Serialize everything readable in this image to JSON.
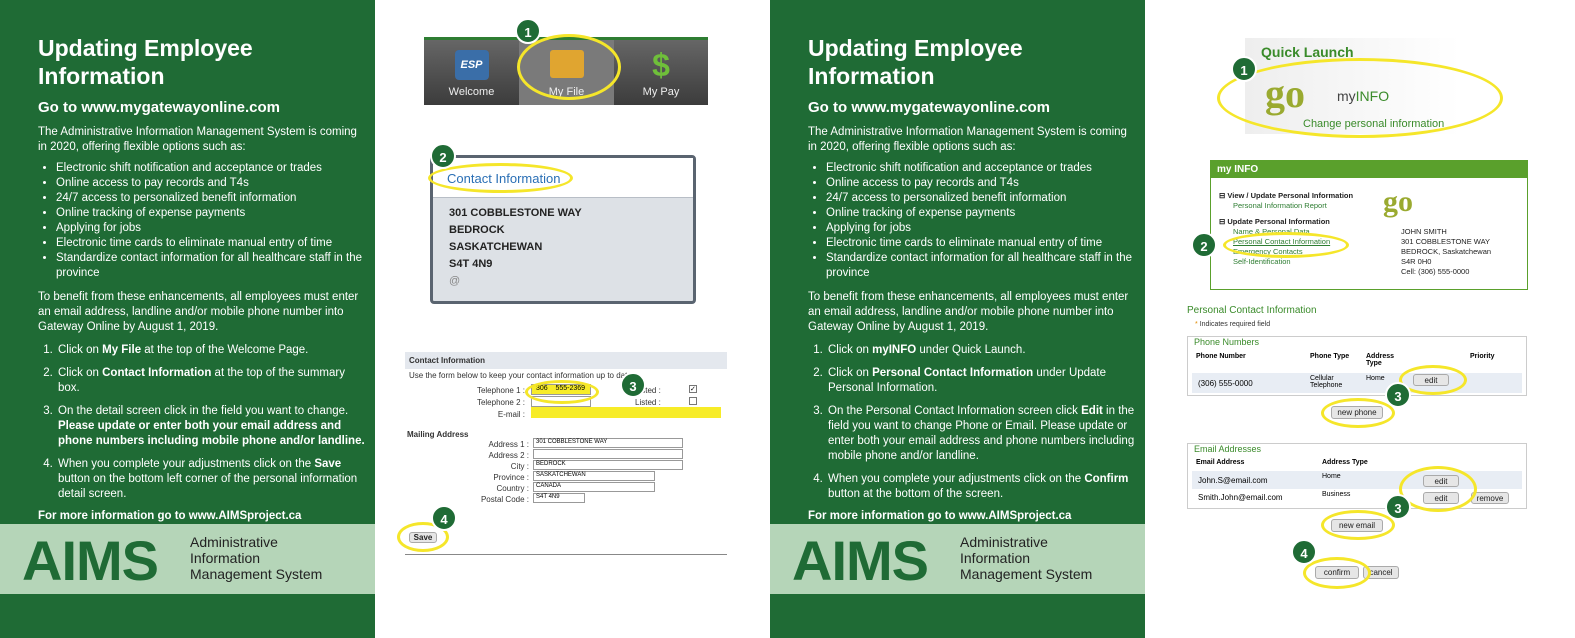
{
  "left_panel": {
    "title": "Updating Employee Information",
    "url_heading": "Go to www.mygatewayonline.com",
    "intro": "The Administrative Information Management System is coming in 2020, offering flexible options such as:",
    "bullets": [
      "Electronic shift notification and acceptance or trades",
      "Online access to pay records and T4s",
      "24/7 access to personalized benefit information",
      "Online tracking of expense payments",
      "Applying for jobs",
      "Electronic time cards to eliminate manual entry of time",
      "Standardize contact information for all healthcare staff in the province"
    ],
    "benefit": "To benefit from these enhancements, all employees must enter an email address, landline and/or mobile phone number into Gateway Online by August 1, 2019.",
    "steps": [
      {
        "pre": "Click on ",
        "bold": "My File",
        "post": " at the top of the Welcome Page."
      },
      {
        "pre": "Click on ",
        "bold": "Contact Information",
        "post": " at the top of the summary box."
      },
      {
        "pre": "On the detail screen click in the field you want to change. ",
        "bold": "Please update or enter both your email address and phone numbers including mobile phone and/or landline.",
        "post": ""
      },
      {
        "pre": "When you complete your adjustments click on the ",
        "bold": "Save",
        "post": " button on the bottom left corner of the personal information detail screen."
      }
    ],
    "more": "For more information go to www.AIMSproject.ca"
  },
  "right_panel": {
    "title": "Updating Employee Information",
    "url_heading": "Go to www.mygatewayonline.com",
    "intro": "The Administrative Information Management System is coming in 2020, offering flexible options such as:",
    "bullets": [
      "Electronic shift notification and acceptance or trades",
      "Online access to pay records and T4s",
      "24/7 access to personalized benefit information",
      "Online tracking of expense payments",
      "Applying for jobs",
      "Electronic time cards to eliminate manual entry of time",
      "Standardize contact information for all healthcare staff in the province"
    ],
    "benefit": "To benefit from these enhancements, all employees must enter an email address, landline and/or mobile phone number into Gateway Online by August 1, 2019.",
    "steps": [
      {
        "pre": "Click on ",
        "bold": "myINFO",
        "post": " under Quick Launch."
      },
      {
        "pre": "Click on ",
        "bold": "Personal Contact Information",
        "post": " under Update Personal Information."
      },
      {
        "pre": "On the Personal Contact Information screen click ",
        "bold": "Edit",
        "post": " in the field you want to change Phone or Email. Please update or enter both your email address and phone numbers including mobile phone and/or landline."
      },
      {
        "pre": "When you complete your adjustments click on the ",
        "bold": "Confirm",
        "post": " button at the bottom of the screen."
      }
    ],
    "more": "For more information go to www.AIMSproject.ca"
  },
  "logo": {
    "text": "AIMS",
    "line1": "Administrative",
    "line2": "Information",
    "line3": "Management System"
  },
  "shot1": {
    "nav": [
      "Welcome",
      "My File",
      "My Pay"
    ],
    "esp": "ESP",
    "contact_title": "Contact Information",
    "address": [
      "301 COBBLESTONE WAY",
      "BEDROCK",
      "SASKATCHEWAN",
      "S4T 4N9"
    ],
    "at": "@",
    "form_title": "Contact Information",
    "form_note": "Use the form below to keep your contact information up to date.",
    "tel1_label": "Telephone 1 :",
    "tel1_area": "306",
    "tel1_num": "555-2369",
    "tel2_label": "Telephone 2 :",
    "email_label": "E-mail :",
    "listed": "Listed :",
    "mailing": "Mailing Address",
    "addr1_label": "Address 1 :",
    "addr1": "301 COBBLESTONE WAY",
    "addr2_label": "Address 2 :",
    "city_label": "City :",
    "city": "BEDROCK",
    "prov_label": "Province :",
    "prov": "SASKATCHEWAN",
    "country_label": "Country :",
    "country": "CANADA",
    "postal_label": "Postal Code :",
    "postal": "S4T 4N9",
    "save": "Save"
  },
  "shot2": {
    "quick_launch": "Quick Launch",
    "my": "my",
    "info": "INFO",
    "change": "Change personal information",
    "box_title": "my INFO",
    "view_update": "View / Update Personal Information",
    "report": "Personal Information Report",
    "update": "Update Personal Information",
    "links": [
      "Name & Personal Data",
      "Personal Contact Information",
      "Emergency Contacts",
      "Self-Identification"
    ],
    "person": [
      "JOHN SMITH",
      "301 COBBLESTONE WAY",
      "BEDROCK, Saskatchewan",
      "S4R 0H0",
      "Cell: (306) 555-0000"
    ],
    "pci": "Personal Contact Information",
    "required": "Indicates required field",
    "phone_numbers": "Phone Numbers",
    "phone_headers": [
      "Phone Number",
      "Phone Type",
      "Address Type",
      "Priority"
    ],
    "phone_row": [
      "(306) 555-0000",
      "Cellular Telephone",
      "Home"
    ],
    "edit": "edit",
    "new_phone": "new phone",
    "email_addresses": "Email Addresses",
    "email_headers": [
      "Email Address",
      "Address Type"
    ],
    "emails": [
      [
        "John.S@email.com",
        "Home"
      ],
      [
        "Smith.John@email.com",
        "Business"
      ]
    ],
    "remove": "remove",
    "new_email": "new email",
    "confirm": "confirm",
    "cancel": "cancel"
  },
  "badges": [
    "1",
    "2",
    "3",
    "4"
  ]
}
